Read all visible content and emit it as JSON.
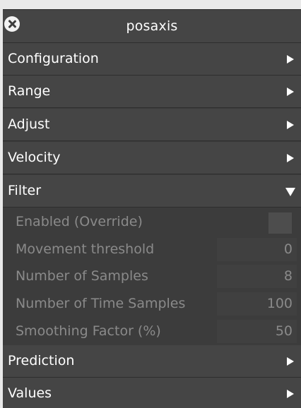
{
  "window": {
    "title": "posaxis",
    "close_icon": "close-circle-icon"
  },
  "colors": {
    "background": "#3c3c3c",
    "header": "#454545",
    "text": "#ffffff",
    "disabled_text": "#8a8a8a"
  },
  "sections": [
    {
      "label": "Configuration",
      "expanded": false
    },
    {
      "label": "Range",
      "expanded": false
    },
    {
      "label": "Adjust",
      "expanded": false
    },
    {
      "label": "Velocity",
      "expanded": false
    },
    {
      "label": "Filter",
      "expanded": true
    },
    {
      "label": "Prediction",
      "expanded": false
    },
    {
      "label": "Values",
      "expanded": false
    }
  ],
  "filter": {
    "enabled_label": "Enabled  (Override)",
    "enabled_checked": false,
    "movement_threshold_label": "Movement threshold",
    "movement_threshold_value": "0",
    "number_of_samples_label": "Number of Samples",
    "number_of_samples_value": "8",
    "number_of_time_samples_label": "Number of Time Samples",
    "number_of_time_samples_value": "100",
    "smoothing_factor_label": "Smoothing Factor (%)",
    "smoothing_factor_value": "50"
  }
}
